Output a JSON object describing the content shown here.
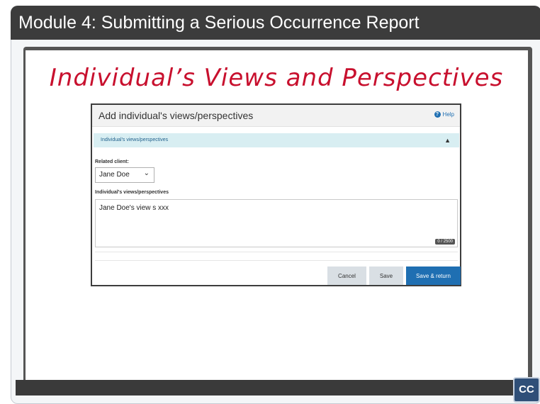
{
  "module_title": "Module 4:  Submitting a Serious Occurrence Report",
  "slide_heading": "Individual’s Views and Perspectives",
  "dialog": {
    "title": "Add individual's views/perspectives",
    "help_label": "Help",
    "section_label": "Individual's views/perspectives",
    "related_client_label": "Related client:",
    "related_client_value": "Jane Doe",
    "views_label": "Individual's views/perspectives",
    "views_value": "Jane Doe's view s xxx",
    "char_count": "0 / 2500",
    "buttons": {
      "cancel": "Cancel",
      "save": "Save",
      "save_return": "Save & return"
    }
  },
  "cc_label": "CC",
  "colors": {
    "title_bar": "#3c3c3c",
    "heading": "#c8102e",
    "primary_button": "#1f6fb2",
    "section_bar": "#d8eef2"
  }
}
